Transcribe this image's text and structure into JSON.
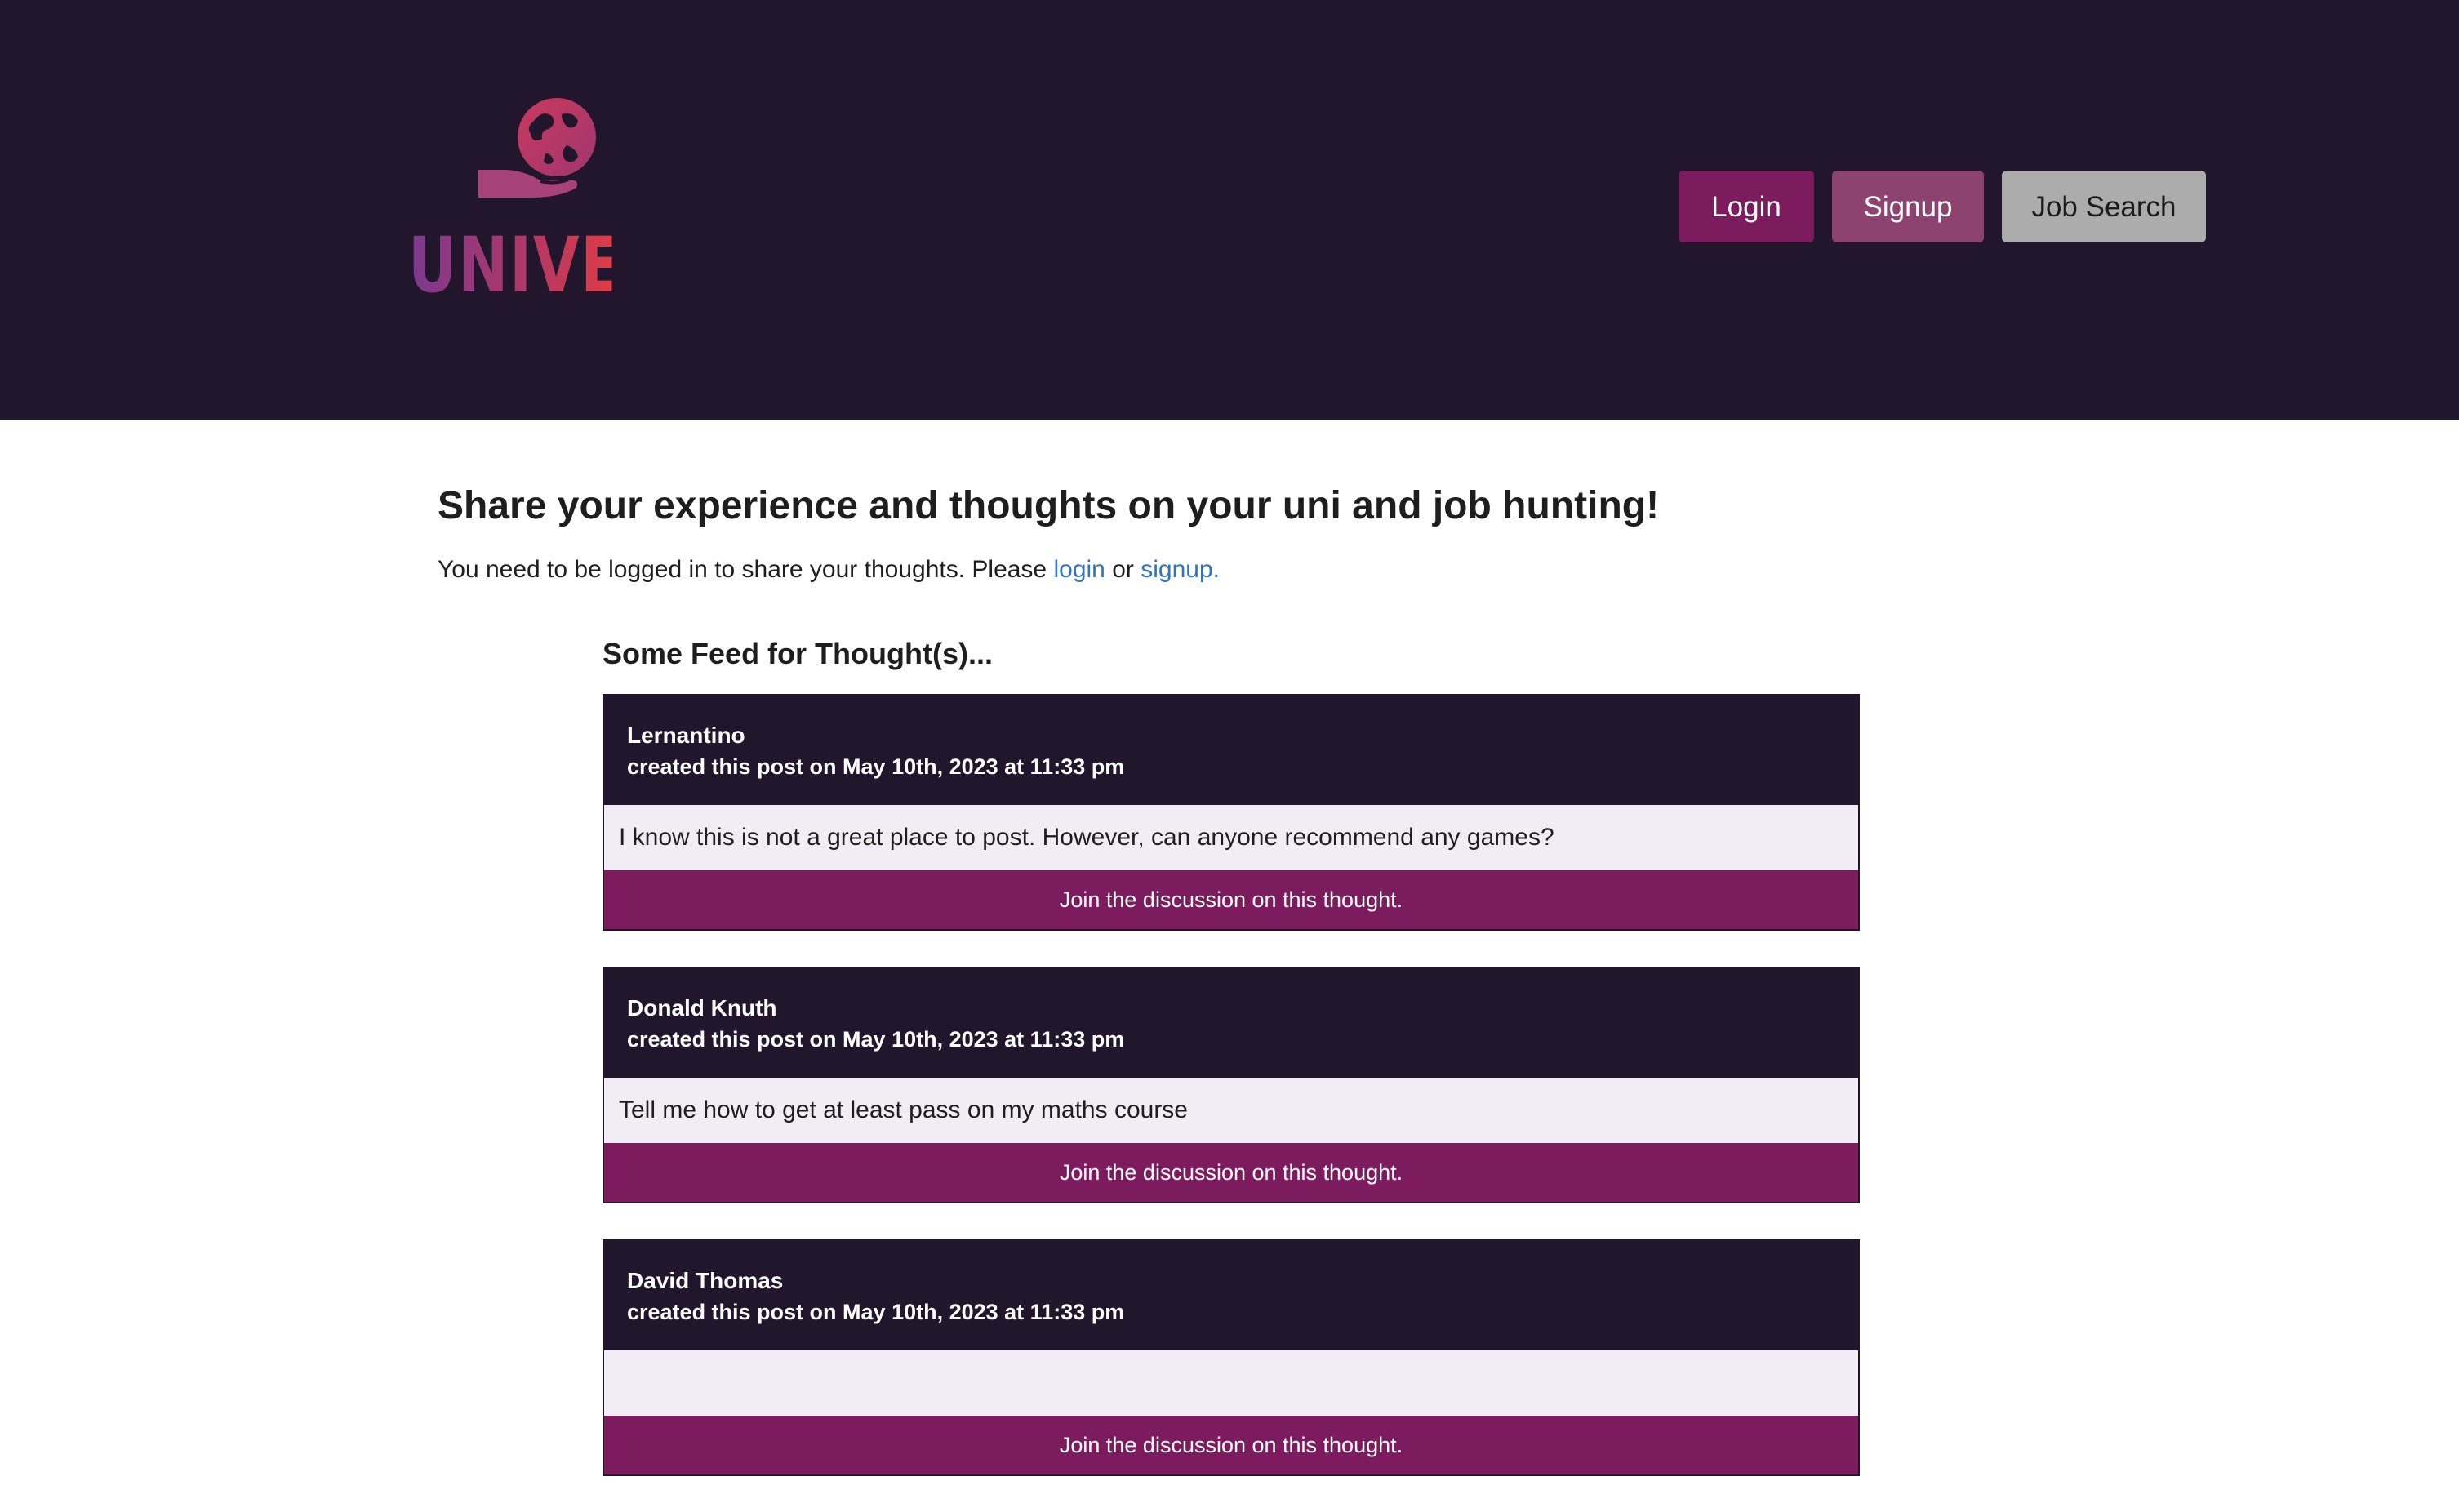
{
  "brand": {
    "name": "UNIVERSE",
    "colors": {
      "header_bg": "#22162d",
      "primary": "#7c1b5d",
      "secondary": "#8c4370",
      "neutral": "#acacac",
      "link": "#2f74c0",
      "post_body_bg": "#f2edf4"
    },
    "logo_icon": "globe-in-hand-icon"
  },
  "nav": {
    "login": "Login",
    "signup": "Signup",
    "job_search": "Job Search"
  },
  "main": {
    "title": "Share your experience and thoughts on your uni and job hunting!",
    "note_prefix": "You need to be logged in to share your thoughts. Please",
    "note_login": "login",
    "note_or": "or",
    "note_signup": "signup.",
    "feed_title": "Some Feed for Thought(s)..."
  },
  "posts": [
    {
      "author": "Lernantino",
      "meta": "created this post on May 10th, 2023 at 11:33 pm",
      "text": "I know this is not a great place to post. However, can anyone recommend any games?",
      "join": "Join the discussion on this thought."
    },
    {
      "author": "Donald Knuth",
      "meta": "created this post on May 10th, 2023 at 11:33 pm",
      "text": "Tell me how to get at least pass on my maths course",
      "join": "Join the discussion on this thought."
    },
    {
      "author": "David Thomas",
      "meta": "created this post on May 10th, 2023 at 11:33 pm",
      "text": "",
      "join": "Join the discussion on this thought."
    }
  ]
}
